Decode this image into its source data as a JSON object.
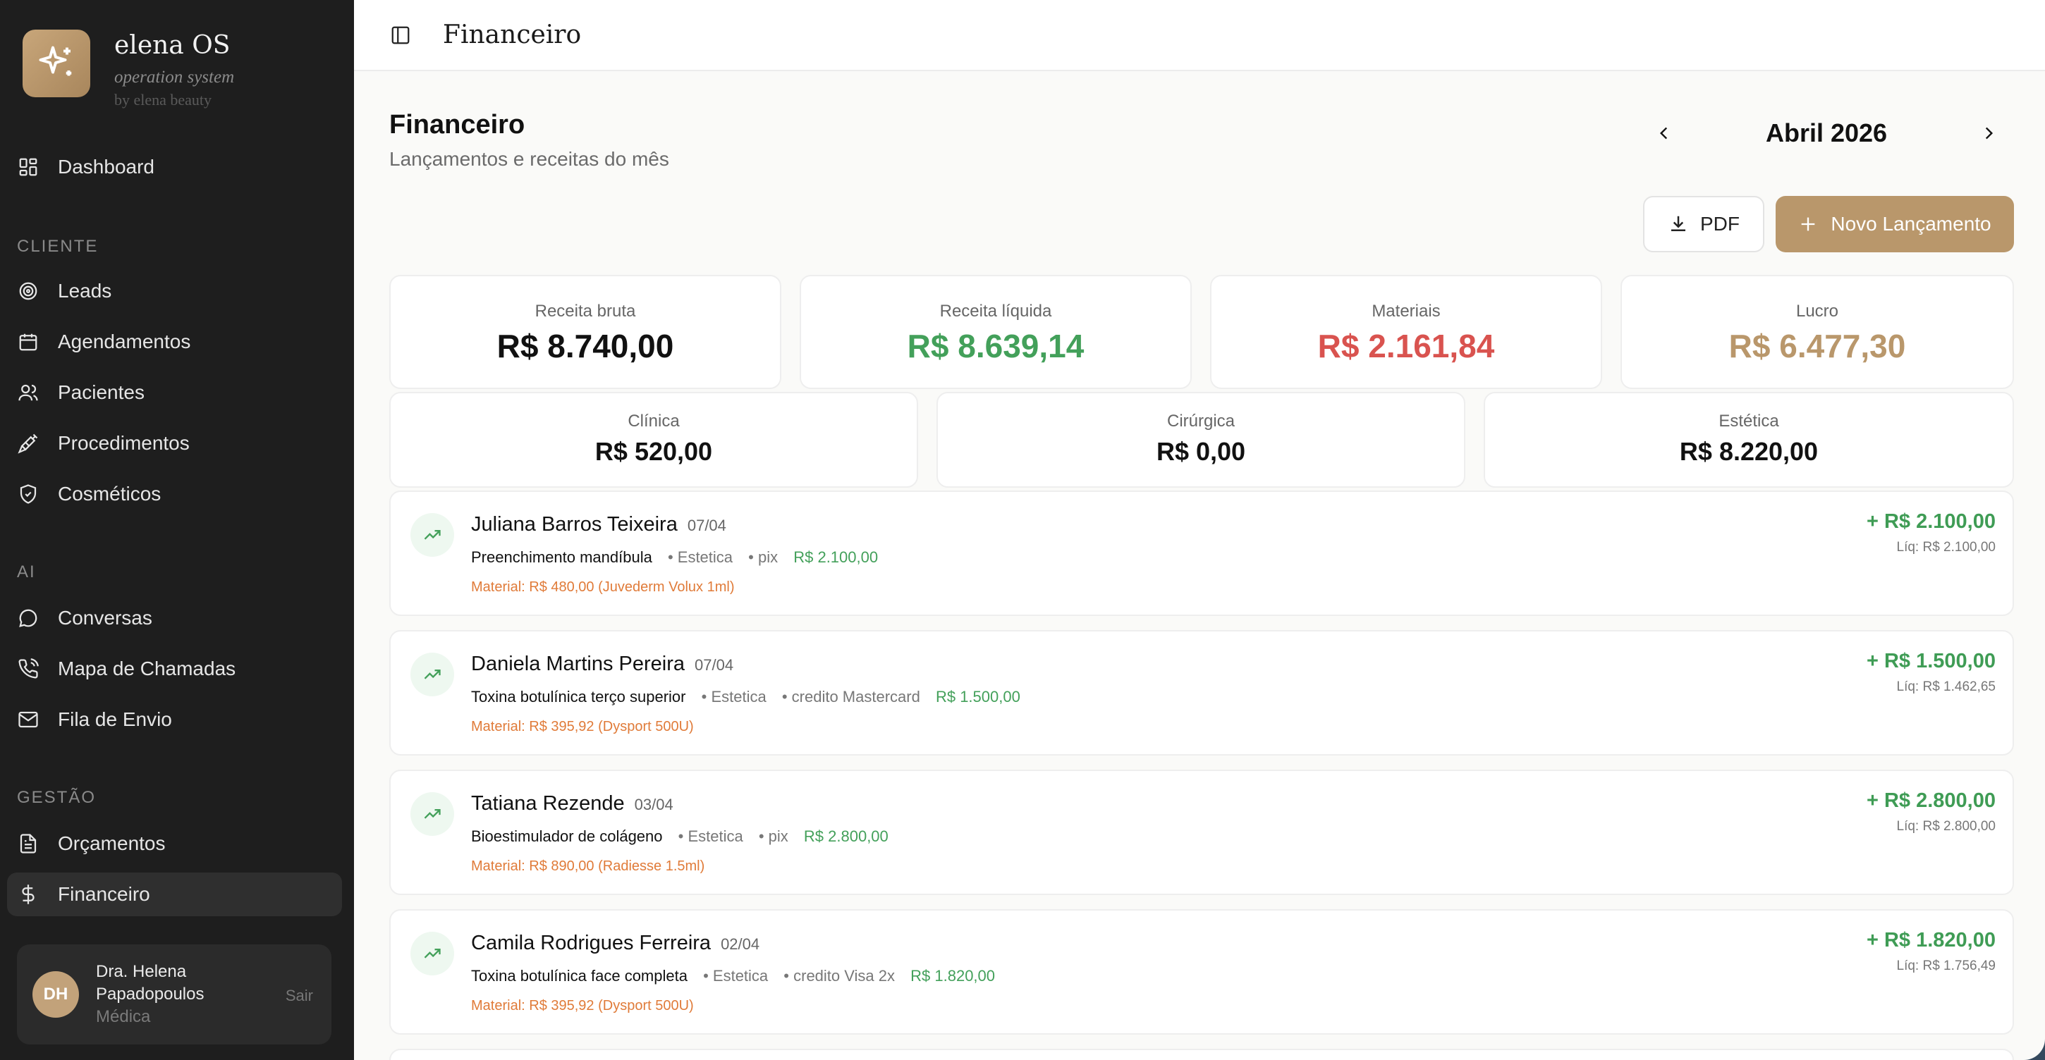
{
  "brand": {
    "name": "elena OS",
    "subtitle": "operation system",
    "by": "by elena beauty"
  },
  "sidebar": {
    "dashboard": "Dashboard",
    "section_cliente": "CLIENTE",
    "leads": "Leads",
    "agendamentos": "Agendamentos",
    "pacientes": "Pacientes",
    "procedimentos": "Procedimentos",
    "cosmeticos": "Cosméticos",
    "section_ai": "AI",
    "conversas": "Conversas",
    "mapa": "Mapa de Chamadas",
    "fila": "Fila de Envio",
    "section_gestao": "GESTÃO",
    "orcamentos": "Orçamentos",
    "financeiro": "Financeiro"
  },
  "user": {
    "initials": "DH",
    "name": "Dra. Helena Papadopoulos",
    "role": "Médica",
    "logout": "Sair"
  },
  "topbar": {
    "title": "Financeiro"
  },
  "page": {
    "title": "Financeiro",
    "subtitle": "Lançamentos e receitas do mês",
    "month": "Abril 2026"
  },
  "actions": {
    "pdf": "PDF",
    "new": "Novo Lançamento"
  },
  "summary": {
    "receita_bruta": {
      "label": "Receita bruta",
      "value": "R$ 8.740,00"
    },
    "receita_liquida": {
      "label": "Receita líquida",
      "value": "R$ 8.639,14"
    },
    "materiais": {
      "label": "Materiais",
      "value": "R$ 2.161,84"
    },
    "lucro": {
      "label": "Lucro",
      "value": "R$ 6.477,30"
    },
    "clinica": {
      "label": "Clínica",
      "value": "R$ 520,00"
    },
    "cirurgica": {
      "label": "Cirúrgica",
      "value": "R$ 0,00"
    },
    "estetica": {
      "label": "Estética",
      "value": "R$ 8.220,00"
    }
  },
  "colors": {
    "accent": "#b9976b",
    "green": "#43a05a",
    "red": "#d9534f",
    "orange": "#e07b39",
    "sidebar": "#1e1e1e"
  },
  "transactions": [
    {
      "name": "Juliana Barros Teixeira",
      "date": "07/04",
      "procedure": "Preenchimento mandíbula",
      "category": "• Estetica",
      "payment": "• pix",
      "amount": "R$ 2.100,00",
      "material": "Material: R$ 480,00 (Juvederm Volux 1ml)",
      "total": "+ R$ 2.100,00",
      "liq": "Líq: R$ 2.100,00"
    },
    {
      "name": "Daniela Martins Pereira",
      "date": "07/04",
      "procedure": "Toxina botulínica terço superior",
      "category": "• Estetica",
      "payment": "• credito Mastercard",
      "amount": "R$ 1.500,00",
      "material": "Material: R$ 395,92 (Dysport 500U)",
      "total": "+ R$ 1.500,00",
      "liq": "Líq: R$ 1.462,65"
    },
    {
      "name": "Tatiana Rezende",
      "date": "03/04",
      "procedure": "Bioestimulador de colágeno",
      "category": "• Estetica",
      "payment": "• pix",
      "amount": "R$ 2.800,00",
      "material": "Material: R$ 890,00 (Radiesse 1.5ml)",
      "total": "+ R$ 2.800,00",
      "liq": "Líq: R$ 2.800,00"
    },
    {
      "name": "Camila Rodrigues Ferreira",
      "date": "02/04",
      "procedure": "Toxina botulínica face completa",
      "category": "• Estetica",
      "payment": "• credito Visa 2x",
      "amount": "R$ 1.820,00",
      "material": "Material: R$ 395,92 (Dysport 500U)",
      "total": "+ R$ 1.820,00",
      "liq": "Líq: R$ 1.756,49"
    }
  ]
}
